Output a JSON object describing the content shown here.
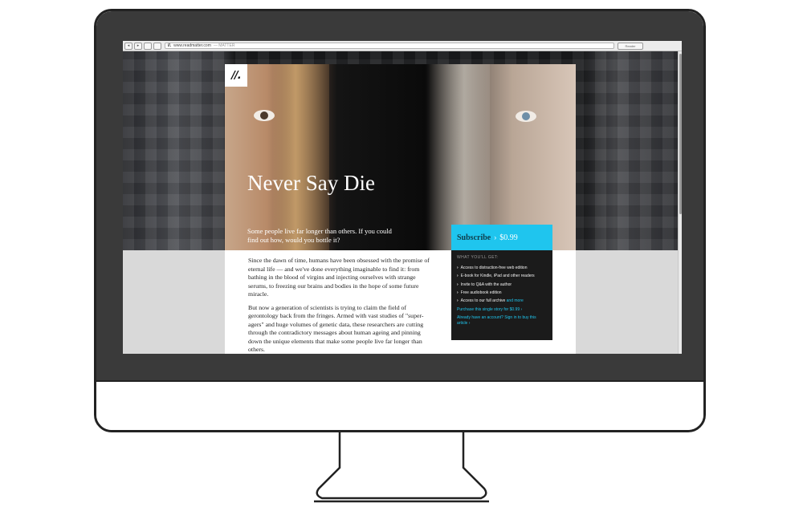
{
  "browser": {
    "back": "◂",
    "forward": "▸",
    "url_logo": "//.",
    "url": "www.readmatter.com",
    "url_suffix": "— MATTER",
    "reader": "Reader"
  },
  "hero": {
    "logo": "//.",
    "title": "Never Say Die",
    "subtitle": "Some people live far longer than others. If you could find out how, would you bottle it?"
  },
  "article": {
    "paragraphs": [
      "Since the dawn of time, humans have been obsessed with the promise of eternal life — and we've done everything imaginable to find it: from bathing in the blood of virgins and injecting ourselves with strange serums, to freezing our brains and bodies in the hope of some future miracle.",
      "But now a generation of scientists is trying to claim the field of gerontology back from the fringes. Armed with vast studies of \"super-agers\" and huge volumes of genetic data, these researchers are cutting through the contradictory messages about human ageing and pinning down the unique elements that make some people live far longer than others."
    ]
  },
  "subscribe": {
    "label": "Subscribe",
    "arrow": "›",
    "price": "$0.99",
    "heading": "WHAT YOU'LL GET:",
    "benefits": [
      "Access to distraction-free web edition",
      "E-book for Kindle, iPad and other readers",
      "Invite to Q&A with the author",
      "Free audiobook edition",
      "Access to our full archive"
    ],
    "benefits_more": "and more",
    "purchase_link": "Purchase this single story for $0.99 ›",
    "signin_link": "Already have an account? Sign in to buy this article ›"
  },
  "colors": {
    "accent": "#1fc5ee",
    "panel": "#1b1b1b",
    "bezel": "#3a3a3a"
  }
}
